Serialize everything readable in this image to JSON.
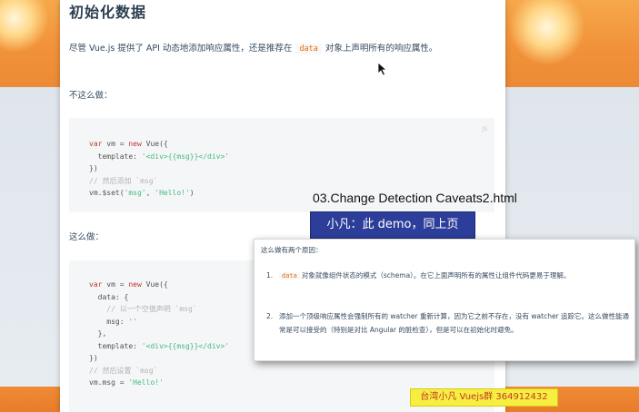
{
  "doc": {
    "heading": "初始化数据",
    "para1_before": "尽管 Vue.js 提供了 API 动态地添加响应属性，还是推荐在",
    "para1_code": "data",
    "para1_after": "对象上声明所有的响应属性。",
    "para2": "不这么做：",
    "para3": "这么做：",
    "code1_tag": "JS",
    "code1": [
      {
        "parts": [
          {
            "t": "var ",
            "c": "kw"
          },
          {
            "t": "vm = "
          },
          {
            "t": "new ",
            "c": "kw"
          },
          {
            "t": "Vue({"
          }
        ]
      },
      {
        "parts": [
          {
            "t": "  template: "
          },
          {
            "t": "'<div>{{msg}}</div>'",
            "c": "str"
          }
        ]
      },
      {
        "parts": [
          {
            "t": "})"
          }
        ]
      },
      {
        "parts": [
          {
            "t": "// 然后添加 `msg`",
            "c": "cm"
          }
        ]
      },
      {
        "parts": [
          {
            "t": "vm.$set("
          },
          {
            "t": "'msg'",
            "c": "str"
          },
          {
            "t": ", "
          },
          {
            "t": "'Hello!'",
            "c": "str"
          },
          {
            "t": ")"
          }
        ]
      }
    ],
    "code2": [
      {
        "parts": [
          {
            "t": "var ",
            "c": "kw"
          },
          {
            "t": "vm = "
          },
          {
            "t": "new ",
            "c": "kw"
          },
          {
            "t": "Vue({"
          }
        ]
      },
      {
        "parts": [
          {
            "t": "  data: {"
          }
        ]
      },
      {
        "parts": [
          {
            "t": "    // 以一个空值声明 `msg`",
            "c": "cm"
          }
        ]
      },
      {
        "parts": [
          {
            "t": "    msg: "
          },
          {
            "t": "''",
            "c": "str"
          }
        ]
      },
      {
        "parts": [
          {
            "t": "  },"
          }
        ]
      },
      {
        "parts": [
          {
            "t": "  template: "
          },
          {
            "t": "'<div>{{msg}}</div>'",
            "c": "str"
          }
        ]
      },
      {
        "parts": [
          {
            "t": "})"
          }
        ]
      },
      {
        "parts": [
          {
            "t": "// 然后设置 `msg`",
            "c": "cm"
          }
        ]
      },
      {
        "parts": [
          {
            "t": "vm.msg = "
          },
          {
            "t": "'Hello!'",
            "c": "str"
          }
        ]
      }
    ]
  },
  "overlay": {
    "title": "03.Change Detection Caveats2.html",
    "subtitle": "小凡：此 demo，同上页",
    "watermark": "台湾小凡 Vuejs群 364912432"
  },
  "note": {
    "head": "这么做有两个原因：",
    "item1_num": "1.",
    "item1_code": "data",
    "item1_text": "对象就像组件状态的模式（schema）。在它上面声明所有的属性让组件代码更易于理解。",
    "item2_num": "2.",
    "item2_text": "添加一个顶级响应属性会强制所有的 watcher 重新计算，因为它之前不存在，没有 watcher 追踪它。这么做性能通常是可以接受的（特别是对比 Angular 的脏检查），但是可以在初始化时避免。"
  },
  "colors": {
    "orange": "#f1923a",
    "code_keyword": "#c0392b",
    "code_string": "#42b983",
    "subtitle_bg": "#2d3e9a",
    "watermark_bg": "#f7ef3f"
  },
  "icons": [
    "mouse-cursor-icon"
  ]
}
